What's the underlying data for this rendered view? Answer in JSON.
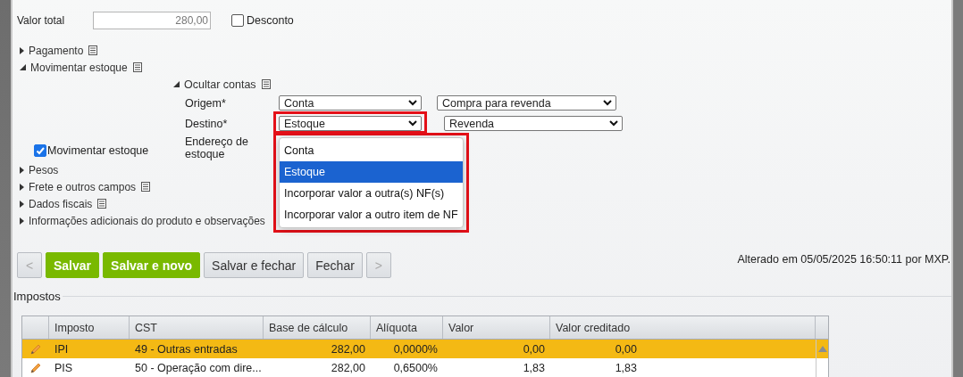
{
  "top_fields": [
    {
      "label": "Valor total",
      "value": "280,00",
      "checkbox": {
        "label": "Desconto",
        "checked": false
      }
    }
  ],
  "sections": [
    {
      "label": "Pagamento",
      "expanded": false,
      "note": true
    },
    {
      "label": "Movimentar estoque",
      "expanded": true,
      "note": true
    },
    {
      "label": "Pesos",
      "expanded": false,
      "note": false
    },
    {
      "label": "Frete e outros campos",
      "expanded": false,
      "note": true
    },
    {
      "label": "Dados fiscais",
      "expanded": false,
      "note": true
    },
    {
      "label": "Informações adicionais do produto e observações",
      "expanded": false,
      "note": false
    }
  ],
  "stock_panel": {
    "subsection": {
      "label": "Ocultar contas",
      "expanded": true
    },
    "rows": [
      {
        "label": "Origem*",
        "selects": [
          "Conta",
          "Compra para revenda"
        ],
        "highlighted": false
      },
      {
        "label": "Destino*",
        "selects": [
          "Estoque",
          "Revenda"
        ],
        "highlighted": true
      },
      {
        "label": "Endereço de estoque"
      }
    ],
    "checkbox": {
      "label": "Movimentar estoque",
      "checked": true
    },
    "dropdown": {
      "highlighted": true,
      "options": [
        {
          "label": "Conta",
          "selected": false
        },
        {
          "label": "Estoque",
          "selected": true
        },
        {
          "label": "Incorporar valor a outra(s) NF(s)",
          "selected": false
        },
        {
          "label": "Incorporar valor a outro item de NF",
          "selected": false
        }
      ]
    }
  },
  "buttons": [
    {
      "label": "<",
      "kind": "nav",
      "disabled": true
    },
    {
      "label": "Salvar",
      "kind": "primary",
      "disabled": false
    },
    {
      "label": "Salvar e novo",
      "kind": "primary",
      "disabled": false
    },
    {
      "label": "Salvar e fechar",
      "kind": "secondary",
      "disabled": false
    },
    {
      "label": "Fechar",
      "kind": "secondary",
      "disabled": false
    },
    {
      "label": ">",
      "kind": "nav",
      "disabled": true
    }
  ],
  "status_text": "Alterado em 05/05/2025 16:50:11 por MXP.",
  "taxes": {
    "title": "Impostos",
    "columns": [
      "Imposto",
      "CST",
      "Base de cálculo",
      "Alíquota",
      "Valor",
      "Valor creditado"
    ],
    "rows": [
      {
        "selected": true,
        "cells": [
          "IPI",
          "49 - Outras entradas",
          "282,00",
          "0,0000%",
          "0,00",
          "0,00"
        ]
      },
      {
        "selected": false,
        "cells": [
          "PIS",
          "50 - Operação com dire...",
          "282,00",
          "0,6500%",
          "1,83",
          "1,83"
        ]
      }
    ]
  }
}
